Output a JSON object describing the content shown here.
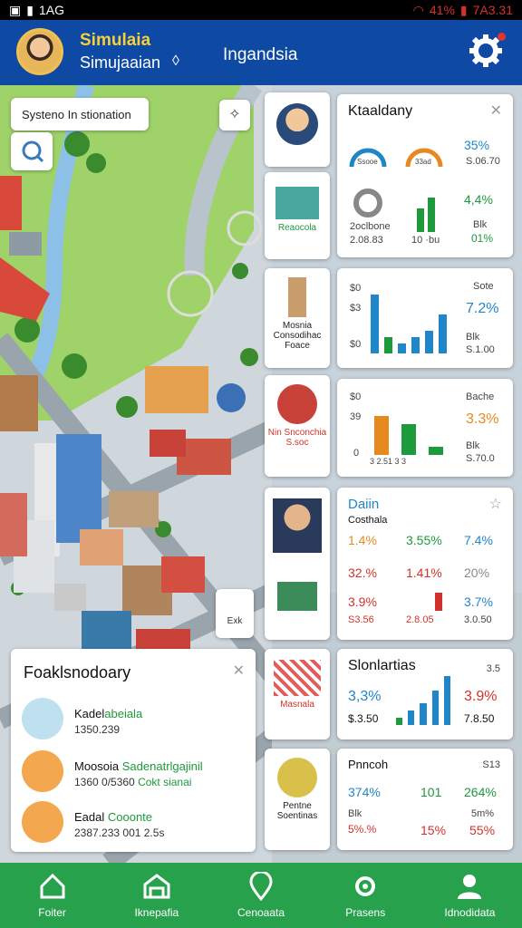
{
  "status": {
    "time": "1AG",
    "battery": "41%",
    "clock": "7A3.31"
  },
  "header": {
    "title": "Simulaia",
    "subtitle": "Simujaaian",
    "region": "Ingandsia"
  },
  "map": {
    "search_text": "Systeno In stionation",
    "ctl2_label": "Exk"
  },
  "thumbs": [
    {
      "label": ""
    },
    {
      "label": "Reaocola"
    },
    {
      "label": "Mosnia Consodihac Foace"
    },
    {
      "label": "Nin Snconchia S.soc"
    },
    {
      "label": ""
    },
    {
      "label": "Masnala"
    },
    {
      "label": "Pentne Soentinas"
    }
  ],
  "card1": {
    "title": "Ktaaldany",
    "g1": "Ssooe",
    "g2": "33ad",
    "v1": "35%",
    "v1s": "S.06.70",
    "v2": "4,4%",
    "v2s": "Blk",
    "v3": "01%",
    "ring_label": "2oclbone",
    "s1": "2.08.83",
    "s2": "10 ·bu"
  },
  "card2": {
    "y1": "$0",
    "y2": "$3",
    "y3": "$0",
    "r1": "Sote",
    "v": "7.2%",
    "r2": "Blk",
    "r3": "S.1.00",
    "bars": [
      0.9,
      0.25,
      0.15,
      0.25,
      0.35,
      0.6
    ]
  },
  "card3": {
    "y1": "$0",
    "y2": "39",
    "y3": "0",
    "ticks": "3  2.51  3  3",
    "r1": "Bache",
    "v": "3.3%",
    "r2": "Blk",
    "r3": "S.70.0",
    "bars": [
      0.7,
      0.55,
      0.15
    ]
  },
  "card4": {
    "title": "Daiin",
    "sub": "Costhala",
    "r1": [
      "1.4%",
      "3.55%",
      "7.4%"
    ],
    "r2": [
      "32.%",
      "1.41%",
      "20%"
    ],
    "r3": [
      "3.9%",
      "",
      "3.7%"
    ],
    "r4": [
      "S3.56",
      "2.8.05",
      "3.0.50"
    ]
  },
  "card5": {
    "title": "Slonlartias",
    "close": "3.5",
    "v1": "3,3%",
    "s1": "$.3.50",
    "v2": "3.9%",
    "s2": "7.8.50",
    "bars": [
      0.15,
      0.3,
      0.45,
      0.7,
      1.0
    ]
  },
  "card6": {
    "title": "Pnncoh",
    "corner": "S13",
    "v1": "374%",
    "v2": "101",
    "v3": "264%",
    "s1": "Blk",
    "s2": "5m%",
    "v4": "5%.%",
    "v5": "15%",
    "v6": "55%"
  },
  "list": {
    "title": "Foaklsnodoary",
    "items": [
      {
        "t1": "Kadel",
        "t2": "abeiala",
        "s": "1350.239",
        "s2": ""
      },
      {
        "t1": "Moosoia",
        "t2": "Sadenatrlgajinil",
        "s": "1360 0/5360",
        "s2": "Cokt sianai"
      },
      {
        "t1": "Eadal",
        "t2": "Cooonte",
        "s": "2387.233",
        "s2": "001 2.5s"
      }
    ]
  },
  "nav": [
    {
      "label": "Foiter",
      "icon": "home-icon"
    },
    {
      "label": "Iknepafia",
      "icon": "garage-icon"
    },
    {
      "label": "Cenoaata",
      "icon": "location-pin-icon"
    },
    {
      "label": "Prasens",
      "icon": "gear-icon"
    },
    {
      "label": "Idnodidata",
      "icon": "user-icon"
    }
  ],
  "colors": {
    "header": "#0e4aa3",
    "nav": "#27a14b",
    "blue": "#1f86c8",
    "green": "#1d9a3b",
    "orange": "#e8891f",
    "red": "#d3322a"
  }
}
